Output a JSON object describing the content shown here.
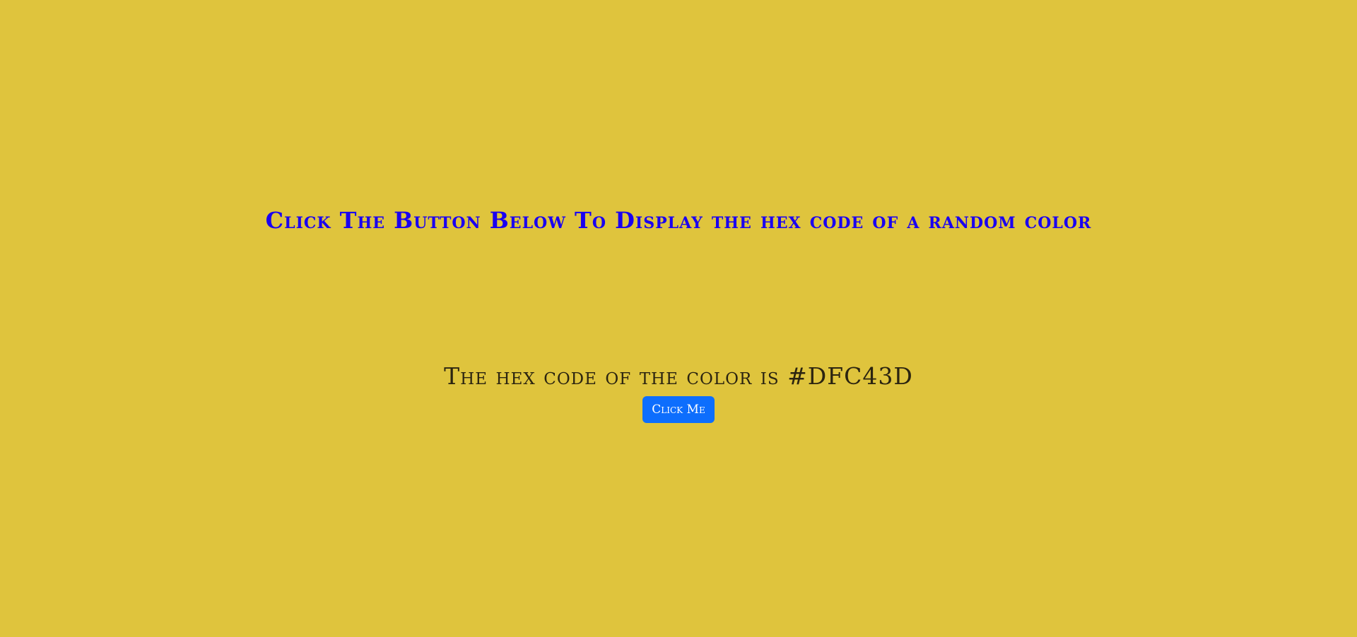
{
  "colors": {
    "background": "#DFC43D",
    "heading": "#1a00f0",
    "button": "#0d6efd"
  },
  "heading": {
    "text": "Click The Button Below To Display the hex code of a random color"
  },
  "result": {
    "text": "The hex code of the color is #DFC43D"
  },
  "button": {
    "label": "Click Me"
  }
}
